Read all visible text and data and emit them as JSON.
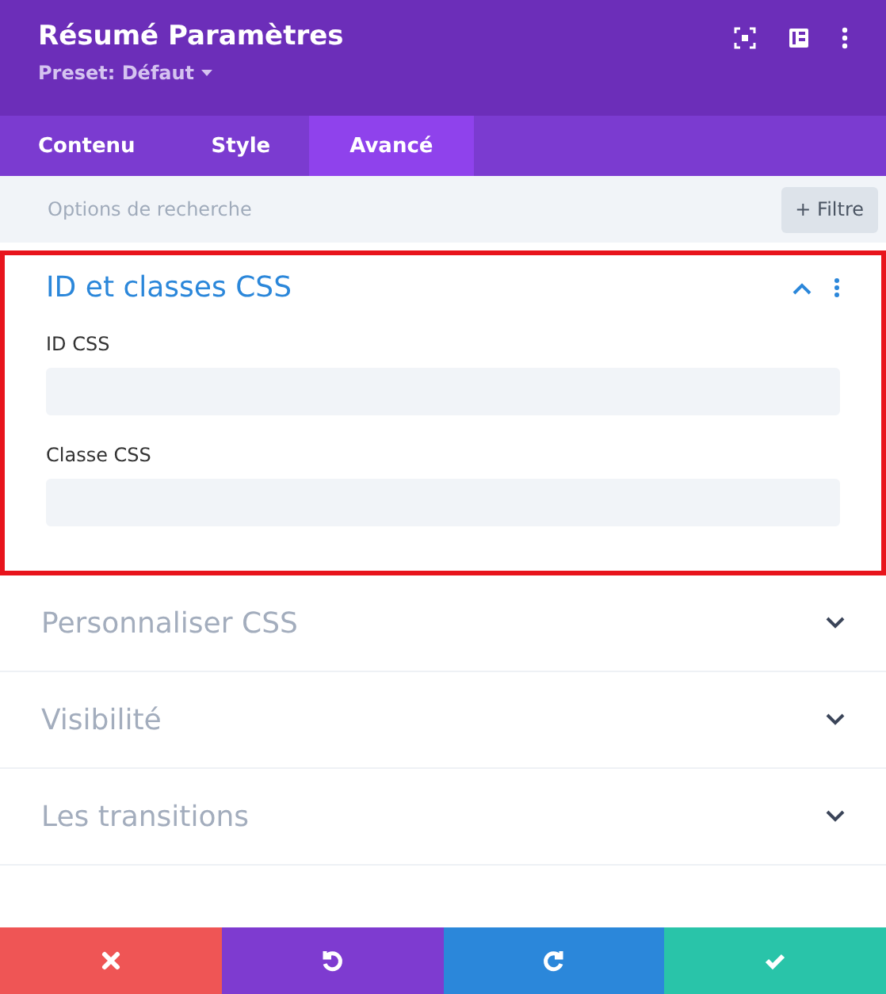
{
  "header": {
    "title": "Résumé Paramètres",
    "preset": "Preset: Défaut"
  },
  "tabs": [
    {
      "label": "Contenu",
      "selected": false
    },
    {
      "label": "Style",
      "selected": false
    },
    {
      "label": "Avancé",
      "selected": true
    }
  ],
  "search": {
    "placeholder": "Options de recherche",
    "filter_button": "+ Filtre"
  },
  "sections": [
    {
      "title": "ID et classes CSS",
      "expanded": true,
      "highlighted": true,
      "fields": [
        {
          "label": "ID CSS"
        },
        {
          "label": "Classe CSS"
        }
      ]
    },
    {
      "title": "Personnaliser CSS",
      "expanded": false,
      "highlighted": false
    },
    {
      "title": "Visibilité",
      "expanded": false,
      "highlighted": false
    },
    {
      "title": "Les transitions",
      "expanded": false,
      "highlighted": false
    }
  ],
  "footer": [
    {
      "kind": "discard"
    },
    {
      "kind": "undo"
    },
    {
      "kind": "redo"
    },
    {
      "kind": "save"
    }
  ]
}
